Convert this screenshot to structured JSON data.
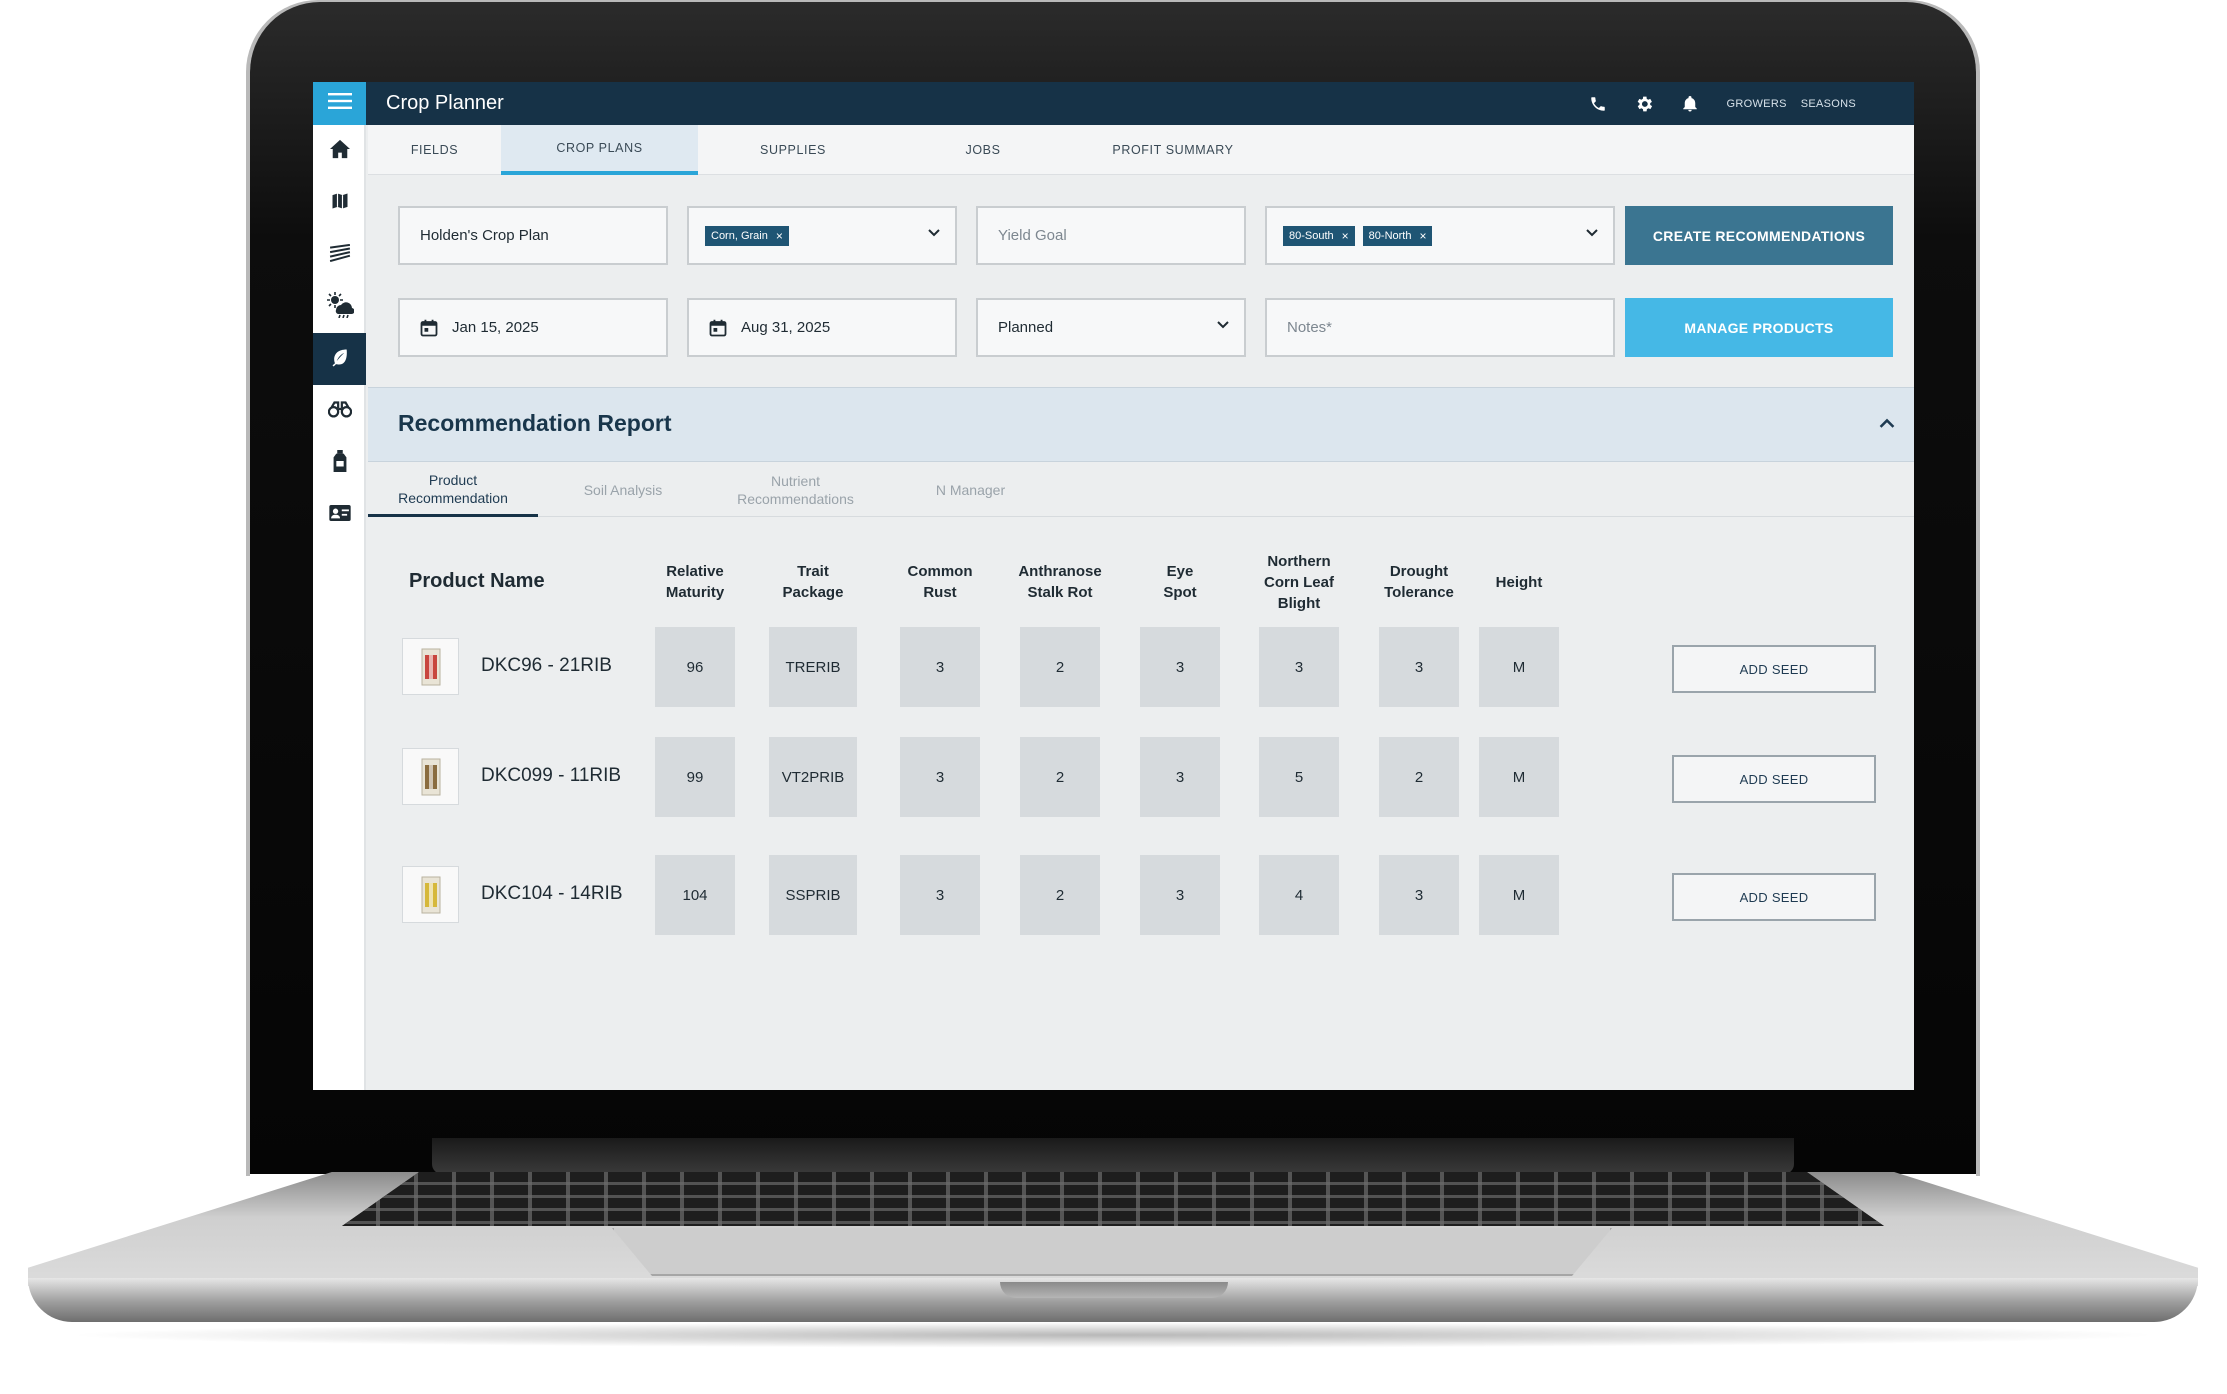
{
  "app": {
    "title": "Crop Planner"
  },
  "header_links": {
    "growers": "GROWERS",
    "seasons": "SEASONS"
  },
  "tabs": [
    {
      "label": "FIELDS"
    },
    {
      "label": "CROP PLANS"
    },
    {
      "label": "SUPPLIES"
    },
    {
      "label": "JOBS"
    },
    {
      "label": "PROFIT SUMMARY"
    }
  ],
  "active_tab": "CROP PLANS",
  "form": {
    "plan_name": "Holden's Crop Plan",
    "crop_chip": "Corn, Grain",
    "yield_goal_placeholder": "Yield Goal",
    "field_chips": [
      "80-South",
      "80-North"
    ],
    "start_date": "Jan 15, 2025",
    "end_date": "Aug 31, 2025",
    "status": "Planned",
    "notes_placeholder": "Notes*"
  },
  "buttons": {
    "create": "CREATE RECOMMENDATIONS",
    "manage": "MANAGE PRODUCTS"
  },
  "report": {
    "title": "Recommendation Report",
    "subtabs": [
      {
        "line1": "Product",
        "line2": "Recommendation"
      },
      {
        "line1": "Soil Analysis",
        "line2": ""
      },
      {
        "line1": "Nutrient",
        "line2": "Recommendations"
      },
      {
        "line1": "N Manager",
        "line2": ""
      }
    ]
  },
  "table": {
    "product_name_header": "Product Name",
    "columns": [
      [
        "Relative",
        "Maturity",
        ""
      ],
      [
        "Trait",
        "Package",
        ""
      ],
      [
        "Common",
        "Rust",
        ""
      ],
      [
        "Anthranose",
        "Stalk Rot",
        ""
      ],
      [
        "Eye",
        "Spot",
        ""
      ],
      [
        "Northern",
        "Corn Leaf",
        "Blight"
      ],
      [
        "Drought",
        "Tolerance",
        ""
      ],
      [
        "Height",
        "",
        ""
      ]
    ],
    "rows": [
      {
        "name": "DKC96 - 21RIB",
        "values": [
          "96",
          "TRERIB",
          "3",
          "2",
          "3",
          "3",
          "3",
          "M"
        ],
        "action": "ADD SEED"
      },
      {
        "name": "DKC099 - 11RIB",
        "values": [
          "99",
          "VT2PRIB",
          "3",
          "2",
          "3",
          "5",
          "2",
          "M"
        ],
        "action": "ADD SEED"
      },
      {
        "name": "DKC104 - 14RIB",
        "values": [
          "104",
          "SSPRIB",
          "3",
          "2",
          "3",
          "4",
          "3",
          "M"
        ],
        "action": "ADD SEED"
      }
    ]
  },
  "icons": {
    "sidebar": [
      "home-icon",
      "map-icon",
      "field-rows-icon",
      "weather-icon",
      "leaf-icon",
      "binoculars-icon",
      "bottle-icon",
      "id-card-icon"
    ],
    "top": [
      "phone-icon",
      "gear-icon",
      "bell-icon"
    ]
  },
  "colors": {
    "topbar": "#163247",
    "accent": "#2aa5d8",
    "create_button": "#3b7591",
    "manage_button": "#45b8e6",
    "chip": "#1f5574"
  }
}
